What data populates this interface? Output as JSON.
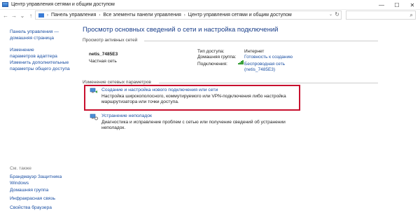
{
  "window": {
    "title": "Центр управления сетями и общим доступом",
    "minimize": "—",
    "maximize": "☐",
    "close": "✕"
  },
  "nav": {
    "back": "←",
    "forward": "→",
    "up_list": "⌄",
    "up": "↑",
    "breadcrumb": [
      "Панель управления",
      "Все элементы панели управления",
      "Центр управления сетями и общим доступом"
    ],
    "separator": "›",
    "dropdown": "⌄",
    "refresh": "↻",
    "search_icon": "⌕"
  },
  "sidebar": {
    "links": [
      "Панель управления — домашняя страница",
      "Изменение параметров адаптера",
      "Изменить дополнительные параметры общего доступа"
    ],
    "see_also_label": "См. также",
    "see_also": [
      "Брандмауэр Защитника Windows",
      "Домашняя группа",
      "Инфракрасная связь",
      "Свойства браузера"
    ]
  },
  "main": {
    "heading": "Просмотр основных сведений о сети и настройка подключений",
    "active_label": "Просмотр активных сетей",
    "network": {
      "name": "netis_7485E3",
      "kind": "Частная сеть",
      "access_type_label": "Тип доступа:",
      "access_type": "Интернет",
      "homegroup_label": "Домашняя группа:",
      "homegroup": "Готовность к созданию",
      "connections_label": "Подключения:",
      "connection_line1": "Беспроводная сеть",
      "connection_line2": "(netis_7485E3)"
    },
    "change_label": "Изменение сетевых параметров",
    "actions": [
      {
        "title": "Создание и настройка нового подключения или сети",
        "desc": "Настройка широкополосного, коммутируемого или VPN-подключения либо настройка маршрутизатора или точки доступа."
      },
      {
        "title": "Устранение неполадок",
        "desc": "Диагностика и исправление проблем с сетью или получение сведений об устранении неполадок."
      }
    ]
  }
}
